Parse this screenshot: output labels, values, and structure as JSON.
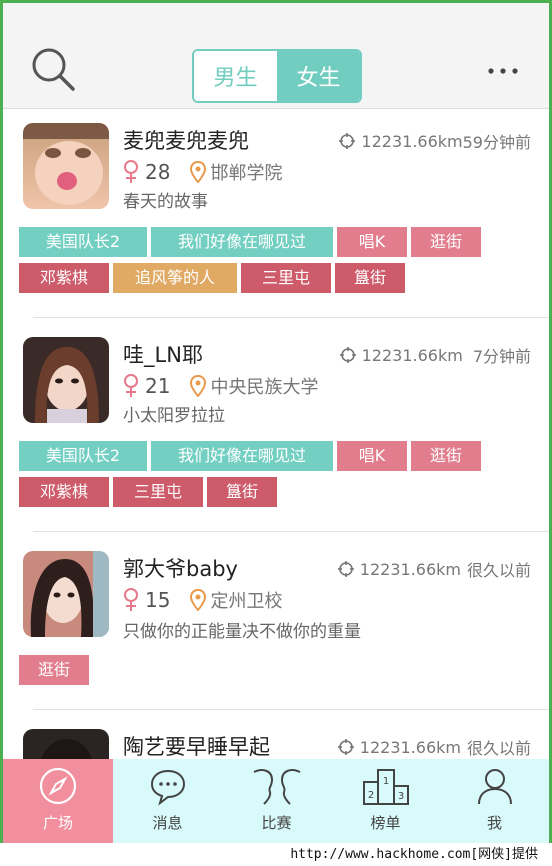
{
  "header": {
    "tabs": [
      {
        "label": "男生",
        "active": false
      },
      {
        "label": "女生",
        "active": true
      }
    ],
    "search_icon": "search-icon",
    "more_icon": "more-icon"
  },
  "feed": [
    {
      "name": "麦兜麦兜麦兜",
      "distance": "12231.66km",
      "time": "59分钟前",
      "age": "28",
      "school": "邯郸学院",
      "signature": "春天的故事",
      "tag_rows": [
        [
          {
            "label": "美国队长2",
            "color": "#73cfc2"
          },
          {
            "label": "我们好像在哪见过",
            "color": "#73cfc2"
          },
          {
            "label": "唱K",
            "color": "#e27d8d"
          },
          {
            "label": "逛街",
            "color": "#e27d8d"
          }
        ],
        [
          {
            "label": "邓紫棋",
            "color": "#cd5b6a"
          },
          {
            "label": "追风筝的人",
            "color": "#e0a964"
          },
          {
            "label": "三里屯",
            "color": "#cd5b6a"
          },
          {
            "label": "簋街",
            "color": "#cd5b6a"
          }
        ]
      ]
    },
    {
      "name": "哇_LN耶",
      "distance": "12231.66km",
      "time": "7分钟前",
      "age": "21",
      "school": "中央民族大学",
      "signature": "小太阳罗拉拉",
      "tag_rows": [
        [
          {
            "label": "美国队长2",
            "color": "#73cfc2"
          },
          {
            "label": "我们好像在哪见过",
            "color": "#73cfc2"
          },
          {
            "label": "唱K",
            "color": "#e27d8d"
          },
          {
            "label": "逛街",
            "color": "#e27d8d"
          }
        ],
        [
          {
            "label": "邓紫棋",
            "color": "#cd5b6a"
          },
          {
            "label": "三里屯",
            "color": "#cd5b6a"
          },
          {
            "label": "簋街",
            "color": "#cd5b6a"
          }
        ]
      ]
    },
    {
      "name": "郭大爷baby",
      "distance": "12231.66km",
      "time": "很久以前",
      "age": "15",
      "school": "定州卫校",
      "signature": "只做你的正能量决不做你的重量",
      "tag_rows": [
        [
          {
            "label": "逛街",
            "color": "#e27d8d"
          }
        ]
      ]
    },
    {
      "name": "陶艺要早睡早起",
      "distance": "12231.66km",
      "time": "很久以前",
      "age": "",
      "school": "",
      "signature": "",
      "tag_rows": []
    }
  ],
  "bottom_nav": [
    {
      "label": "广场",
      "icon": "compass-icon",
      "active": true
    },
    {
      "label": "消息",
      "icon": "chat-bubble-icon",
      "active": false
    },
    {
      "label": "比赛",
      "icon": "faces-icon",
      "active": false
    },
    {
      "label": "榜单",
      "icon": "podium-icon",
      "active": false
    },
    {
      "label": "我",
      "icon": "user-icon",
      "active": false
    }
  ],
  "watermark": "http://www.hackhome.com[网侠]提供",
  "colors": {
    "accent_teal": "#71cdc0",
    "active_nav": "#f28f9e",
    "tag_teal": "#73cfc2",
    "tag_pink": "#e27d8d",
    "tag_red": "#cd5b6a",
    "tag_orange": "#e0a964",
    "female_icon": "#e8788a",
    "location_icon": "#e89a4c"
  }
}
